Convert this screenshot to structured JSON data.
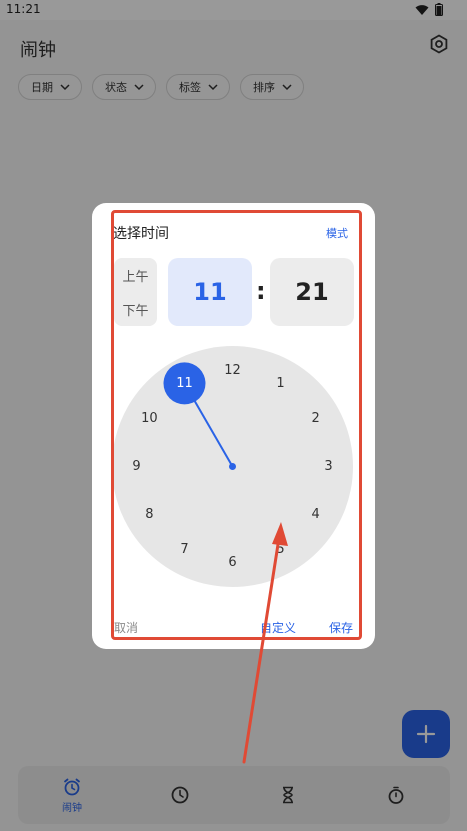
{
  "status_bar": {
    "time": "11:21"
  },
  "app": {
    "title": "闹钟",
    "filters": [
      {
        "label": "日期"
      },
      {
        "label": "状态"
      },
      {
        "label": "标签"
      },
      {
        "label": "排序"
      }
    ]
  },
  "bottom_nav": {
    "items": [
      {
        "label": "闹钟",
        "icon": "alarm-icon",
        "active": true
      },
      {
        "label": "",
        "icon": "clock-icon"
      },
      {
        "label": "",
        "icon": "hourglass-icon"
      },
      {
        "label": "",
        "icon": "stopwatch-icon"
      }
    ]
  },
  "dialog": {
    "title": "选择时间",
    "mode_label": "模式",
    "am_label": "上午",
    "pm_label": "下午",
    "hour": "11",
    "separator": ":",
    "minute": "21",
    "clock_numbers": [
      "12",
      "1",
      "2",
      "3",
      "4",
      "5",
      "6",
      "7",
      "8",
      "9",
      "10",
      "11"
    ],
    "selected_hour": 11,
    "cancel_label": "取消",
    "custom_label": "自定义",
    "save_label": "保存"
  },
  "colors": {
    "accent": "#2a63e6",
    "annotation": "#e04a35",
    "clock_face": "#e6e6e6"
  }
}
